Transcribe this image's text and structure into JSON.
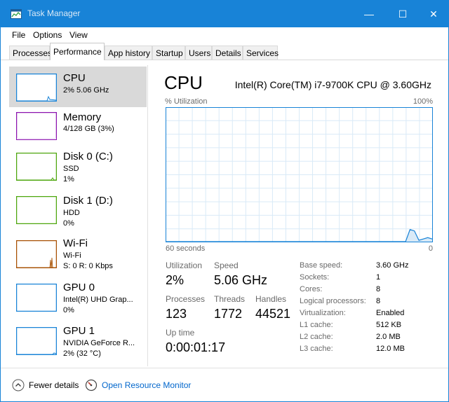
{
  "window": {
    "title": "Task Manager",
    "min_glyph": "—",
    "max_glyph": "☐",
    "close_glyph": "✕",
    "accent": "#1883d7"
  },
  "menu": [
    "File",
    "Options",
    "View"
  ],
  "tabs": [
    "Processes",
    "Performance",
    "App history",
    "Startup",
    "Users",
    "Details",
    "Services"
  ],
  "active_tab": "Performance",
  "resources": [
    {
      "name": "CPU",
      "lines": [
        "2% 5.06 GHz"
      ],
      "color": "#1883d7",
      "icon": "cpu-graph"
    },
    {
      "name": "Memory",
      "lines": [
        "4/128 GB (3%)"
      ],
      "color": "#8b12ae",
      "icon": "memory-graph"
    },
    {
      "name": "Disk 0 (C:)",
      "lines": [
        "SSD",
        "1%"
      ],
      "color": "#4da60c",
      "icon": "disk-graph"
    },
    {
      "name": "Disk 1 (D:)",
      "lines": [
        "HDD",
        "0%"
      ],
      "color": "#4da60c",
      "icon": "disk-graph"
    },
    {
      "name": "Wi-Fi",
      "lines": [
        "Wi-Fi",
        "S: 0 R: 0 Kbps"
      ],
      "color": "#a74f01",
      "icon": "wifi-graph"
    },
    {
      "name": "GPU 0",
      "lines": [
        "Intel(R) UHD Grap...",
        "0%"
      ],
      "color": "#1883d7",
      "icon": "gpu-graph"
    },
    {
      "name": "GPU 1",
      "lines": [
        "NVIDIA GeForce R...",
        "2% (32 °C)"
      ],
      "color": "#1883d7",
      "icon": "gpu-graph"
    }
  ],
  "main": {
    "title": "CPU",
    "cpu_name": "Intel(R) Core(TM) i7-9700K CPU @ 3.60GHz",
    "util_label": "% Utilization",
    "max_label": "100%",
    "time_label": "60 seconds",
    "min_label": "0",
    "utilization_label": "Utilization",
    "utilization_value": "2%",
    "speed_label": "Speed",
    "speed_value": "5.06 GHz",
    "processes_label": "Processes",
    "processes_value": "123",
    "threads_label": "Threads",
    "threads_value": "1772",
    "handles_label": "Handles",
    "handles_value": "44521",
    "uptime_label": "Up time",
    "uptime_value": "0:00:01:17",
    "specs": [
      {
        "key": "Base speed:",
        "value": "3.60 GHz"
      },
      {
        "key": "Sockets:",
        "value": "1"
      },
      {
        "key": "Cores:",
        "value": "8"
      },
      {
        "key": "Logical processors:",
        "value": "8"
      },
      {
        "key": "Virtualization:",
        "value": "Enabled"
      },
      {
        "key": "L1 cache:",
        "value": "512 KB"
      },
      {
        "key": "L2 cache:",
        "value": "2.0 MB"
      },
      {
        "key": "L3 cache:",
        "value": "12.0 MB"
      }
    ]
  },
  "footer": {
    "fewer_details": "Fewer details",
    "open_resource_monitor": "Open Resource Monitor"
  },
  "cpu_history": [
    0,
    0,
    0,
    0,
    0,
    0,
    0,
    0,
    0,
    0,
    0,
    0,
    0,
    0,
    0,
    0,
    0,
    0,
    0,
    0,
    0,
    0,
    0,
    0,
    0,
    0,
    0,
    0,
    0,
    0,
    0,
    0,
    0,
    0,
    0,
    0,
    0,
    0,
    0,
    0,
    0,
    0,
    0,
    0,
    0,
    0,
    0,
    0,
    0,
    0,
    0,
    0,
    0,
    0,
    0,
    9,
    8,
    1,
    2,
    3,
    2
  ]
}
